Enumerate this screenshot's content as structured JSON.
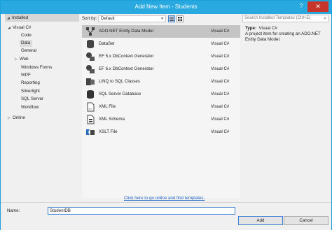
{
  "window": {
    "title": "Add New Item - Students",
    "help": "?",
    "close": "✕"
  },
  "tree": {
    "installed": "Installed",
    "root": "Visual C#",
    "items": [
      "Code",
      "Data",
      "General",
      "Web",
      "Windows Forms",
      "WPF",
      "Reporting",
      "Silverlight",
      "SQL Server",
      "Workflow"
    ],
    "online": "Online"
  },
  "sort": {
    "label": "Sort by:",
    "value": "Default"
  },
  "search": {
    "placeholder": "Search Installed Templates (Ctrl+E)"
  },
  "templates": [
    {
      "name": "ADO.NET Entity Data Model",
      "lang": "Visual C#",
      "icon": "entity-model-icon"
    },
    {
      "name": "DataSet",
      "lang": "Visual C#",
      "icon": "dataset-icon"
    },
    {
      "name": "EF 5.x DbContext Generator",
      "lang": "Visual C#",
      "icon": "ef-generator-icon"
    },
    {
      "name": "EF 6.x DbContext Generator",
      "lang": "Visual C#",
      "icon": "ef-generator-icon"
    },
    {
      "name": "LINQ to SQL Classes",
      "lang": "Visual C#",
      "icon": "linq-icon"
    },
    {
      "name": "SQL Server Database",
      "lang": "Visual C#",
      "icon": "database-icon"
    },
    {
      "name": "XML File",
      "lang": "Visual C#",
      "icon": "xml-file-icon"
    },
    {
      "name": "XML Schema",
      "lang": "Visual C#",
      "icon": "xml-schema-icon"
    },
    {
      "name": "XSLT File",
      "lang": "Visual C#",
      "icon": "xslt-icon"
    }
  ],
  "detail": {
    "type_label": "Type:",
    "type_value": "Visual C#",
    "description": "A project item for creating an ADO.NET Entity Data Model."
  },
  "online_link": "Click here to go online and find templates.",
  "name_field": {
    "label": "Name:",
    "value": "StudentDB"
  },
  "buttons": {
    "add": "Add",
    "cancel": "Cancel"
  }
}
